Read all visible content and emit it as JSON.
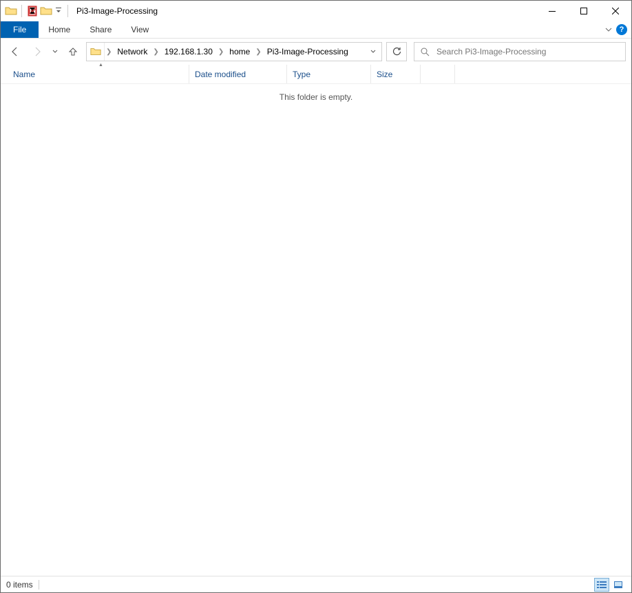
{
  "window": {
    "title": "Pi3-Image-Processing"
  },
  "ribbon": {
    "file": "File",
    "tabs": [
      "Home",
      "Share",
      "View"
    ]
  },
  "breadcrumb": {
    "items": [
      "Network",
      "192.168.1.30",
      "home",
      "Pi3-Image-Processing"
    ]
  },
  "search": {
    "placeholder": "Search Pi3-Image-Processing"
  },
  "columns": {
    "name": "Name",
    "date": "Date modified",
    "type": "Type",
    "size": "Size"
  },
  "content": {
    "empty_message": "This folder is empty."
  },
  "statusbar": {
    "item_count": "0 items"
  }
}
